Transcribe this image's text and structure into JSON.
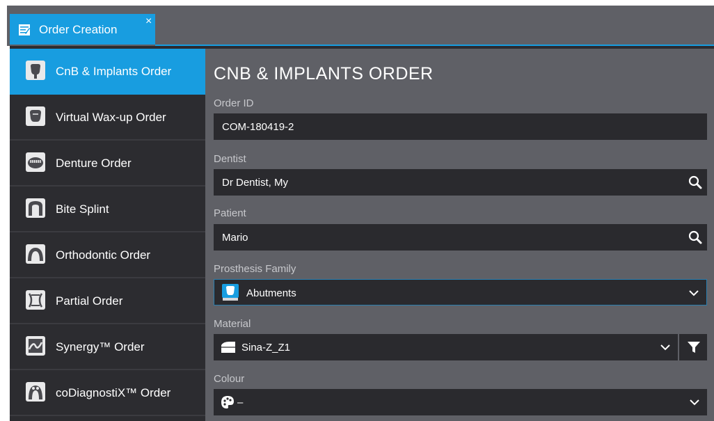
{
  "tab": {
    "label": "Order Creation",
    "close": "×"
  },
  "sidebar": {
    "items": [
      {
        "label": "CnB & Implants Order",
        "icon": "crown-implant-icon",
        "active": true
      },
      {
        "label": "Virtual Wax-up Order",
        "icon": "wax-crown-icon",
        "active": false
      },
      {
        "label": "Denture Order",
        "icon": "denture-icon",
        "active": false
      },
      {
        "label": "Bite Splint",
        "icon": "bite-splint-icon",
        "active": false
      },
      {
        "label": "Orthodontic Order",
        "icon": "orthodontic-icon",
        "active": false
      },
      {
        "label": "Partial Order",
        "icon": "partial-icon",
        "active": false
      },
      {
        "label": "Synergy™ Order",
        "icon": "synergy-icon",
        "active": false
      },
      {
        "label": "coDiagnostiX™ Order",
        "icon": "codiagnostix-icon",
        "active": false
      }
    ]
  },
  "main": {
    "title": "CNB & IMPLANTS ORDER",
    "order_id": {
      "label": "Order ID",
      "value": "COM-180419-2"
    },
    "dentist": {
      "label": "Dentist",
      "value": "Dr Dentist, My"
    },
    "patient": {
      "label": "Patient",
      "value": "Mario"
    },
    "prosthesis_family": {
      "label": "Prosthesis Family",
      "value": "Abutments"
    },
    "material": {
      "label": "Material",
      "value": "Sina-Z_Z1"
    },
    "colour": {
      "label": "Colour",
      "value": "–"
    }
  },
  "colors": {
    "accent": "#189de0",
    "panel": "#5f6066",
    "dark": "#2c2c30",
    "field": "#2a2a2e"
  }
}
